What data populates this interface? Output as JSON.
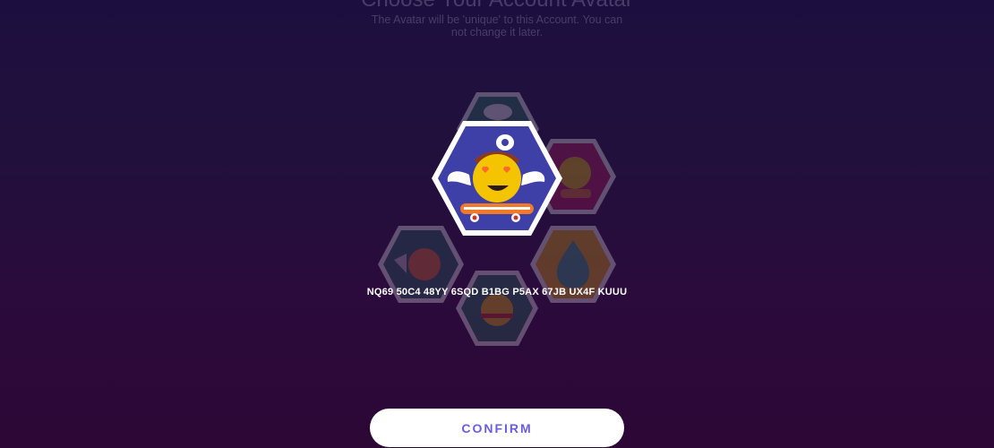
{
  "header": {
    "title": "Choose Your Account Avatar",
    "subtitle": "The Avatar will be 'unique' to this Account. You can not change it later."
  },
  "account_id": "NQ69 50C4 48YY 6SQD B1BG P5AX 67JB UX4F KUUU",
  "confirm_label": "CONFIRM",
  "avatars": [
    {
      "icon": "chef-smiley-avatar-icon",
      "bg": "#2a7a5e"
    },
    {
      "icon": "doctor-smiley-avatar-icon",
      "bg": "#c2185b"
    },
    {
      "icon": "angel-heart-eyes-skateboard-avatar-icon",
      "bg": "#3f3fa8",
      "selected": true
    },
    {
      "icon": "fish-smiley-avatar-icon",
      "bg": "#1f6e5c"
    },
    {
      "icon": "drop-smiley-avatar-icon",
      "bg": "#f2b600"
    },
    {
      "icon": "guitar-smiley-avatar-icon",
      "bg": "#1f7a5a"
    }
  ],
  "colors": {
    "accent": "#6a5ce0",
    "background_top": "#1c0f3f",
    "background_bottom": "#2d0736"
  }
}
